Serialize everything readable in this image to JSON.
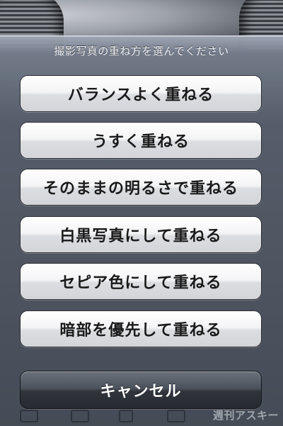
{
  "sheet": {
    "title": "撮影写真の重ね方を選んでください",
    "options": [
      "バランスよく重ねる",
      "うすく重ねる",
      "そのままの明るさで重ねる",
      "白黒写真にして重ねる",
      "セピア色にして重ねる",
      "暗部を優先して重ねる"
    ],
    "cancel_label": "キャンセル"
  },
  "watermark": "週刊アスキー",
  "colors": {
    "sheet_top": "#a0a8b6",
    "sheet_bottom": "#464c57",
    "option_button": "#f4f4f6",
    "cancel_button": "#30343b"
  }
}
